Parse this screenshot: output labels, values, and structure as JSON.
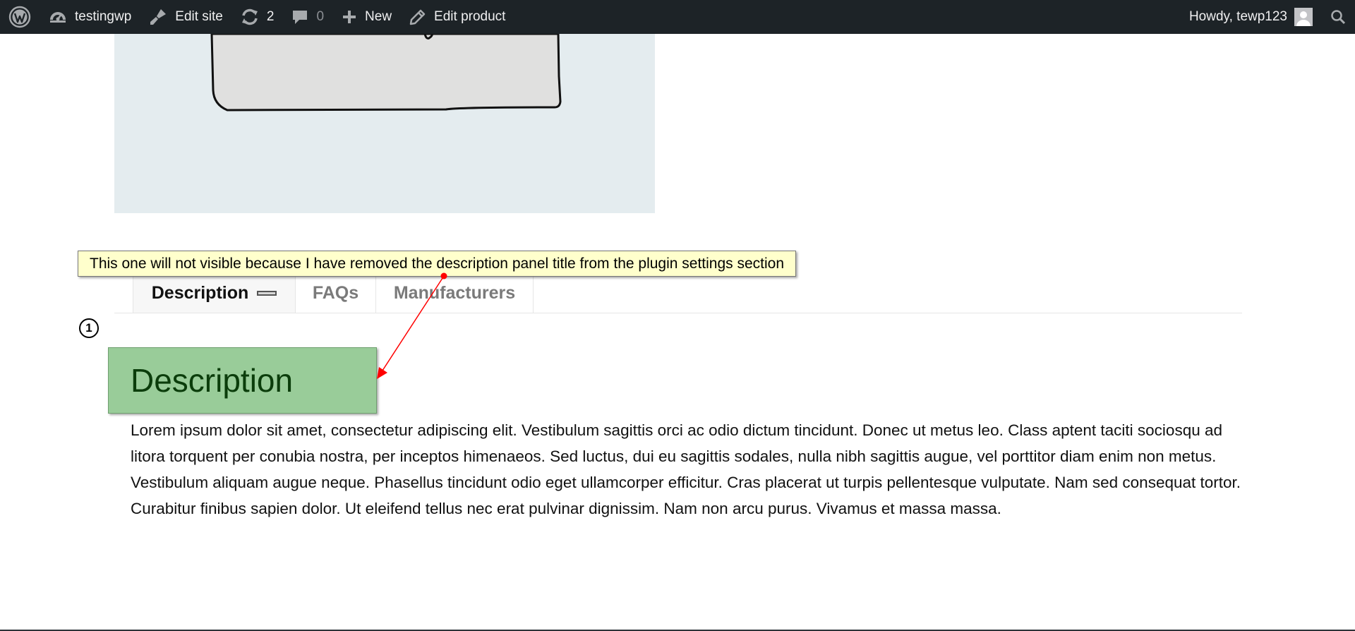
{
  "adminbar": {
    "site_name": "testingwp",
    "edit_site": "Edit site",
    "updates_count": "2",
    "comments_count": "0",
    "new_label": "New",
    "edit_product": "Edit product",
    "greeting": "Howdy, tewp123"
  },
  "tabs": [
    {
      "label": "Description",
      "active": true
    },
    {
      "label": "FAQs",
      "active": false
    },
    {
      "label": "Manufacturers",
      "active": false
    }
  ],
  "annotation": {
    "number": "1",
    "note": "This one will not visible because I have removed the description panel title from the plugin settings section",
    "arrow_color": "#ff0000"
  },
  "content": {
    "heading": "Description",
    "body": "Lorem ipsum dolor sit amet, consectetur adipiscing elit. Vestibulum sagittis orci ac odio dictum tincidunt. Donec ut metus leo. Class aptent taciti sociosqu ad litora torquent per conubia nostra, per inceptos himenaeos. Sed luctus, dui eu sagittis sodales, nulla nibh sagittis augue, vel porttitor diam enim non metus. Vestibulum aliquam augue neque. Phasellus tincidunt odio eget ullamcorper efficitur. Cras placerat ut turpis pellentesque vulputate. Nam sed consequat tortor. Curabitur finibus sapien dolor. Ut eleifend tellus nec erat pulvinar dignissim. Nam non arcu purus. Vivamus et massa massa."
  },
  "colors": {
    "adminbar_bg": "#1d2327",
    "highlight_green": "#99cc99",
    "note_yellow": "#ffffcc"
  }
}
